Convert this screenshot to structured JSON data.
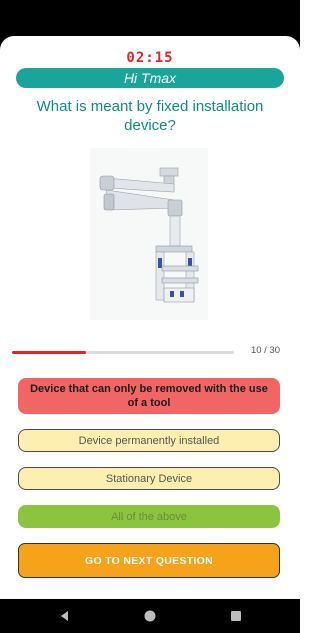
{
  "timer": "02:15",
  "greeting": "Hi Tmax",
  "question": "What is meant by fixed installation device?",
  "image_semantic": "ceiling-mounted-medical-pendant",
  "progress": {
    "current": 10,
    "total": 30,
    "label": "10 / 30"
  },
  "answers": [
    {
      "label": "Device that can only be removed with the use of a tool",
      "state": "wrong"
    },
    {
      "label": "Device permanently installed",
      "state": "neutral"
    },
    {
      "label": "Stationary Device",
      "state": "neutral"
    },
    {
      "label": "All of the above",
      "state": "correct"
    }
  ],
  "next_button": "GO TO NEXT QUESTION",
  "colors": {
    "accent": "#1aa59a",
    "question": "#0d8f80",
    "timer": "#e3242b",
    "wrong": "#f26565",
    "neutral": "#fdefb0",
    "correct": "#8bc53f",
    "next": "#f7a21b"
  },
  "navbar": {
    "icons": [
      "back-icon",
      "home-icon",
      "recents-icon"
    ]
  }
}
